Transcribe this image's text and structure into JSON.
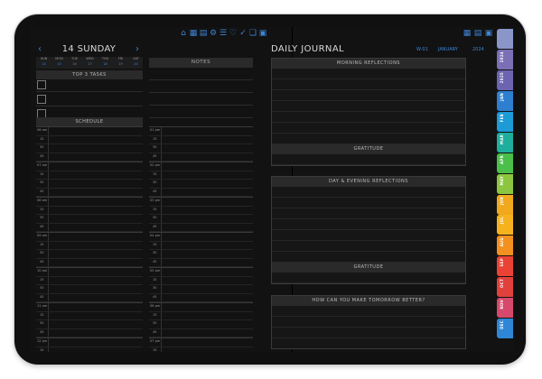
{
  "date_header": {
    "title": "14 SUNDAY",
    "prev": "‹",
    "next": "›"
  },
  "week": {
    "days": [
      "SUN",
      "MON",
      "TUE",
      "WED",
      "THU",
      "FRI",
      "SAT"
    ],
    "dates": [
      "14",
      "15",
      "16",
      "17",
      "18",
      "19",
      "20"
    ]
  },
  "top_icons": [
    "home-icon",
    "calendar-icon",
    "grid-icon",
    "gear-icon",
    "list-icon",
    "heart-icon",
    "checklist-icon",
    "bookmark-icon",
    "clipboard-icon"
  ],
  "right_icons": [
    "grid-icon",
    "calendar-icon",
    "document-icon"
  ],
  "sections": {
    "top_tasks": "TOP 3 TASKS",
    "schedule": "SCHEDULE",
    "notes": "NOTES"
  },
  "schedule_left": [
    {
      "hour": "06 am",
      "q": [
        "15",
        "30",
        "45"
      ]
    },
    {
      "hour": "07 am",
      "q": [
        "15",
        "30",
        "45"
      ]
    },
    {
      "hour": "08 am",
      "q": [
        "15",
        "30",
        "45"
      ]
    },
    {
      "hour": "09 am",
      "q": [
        "15",
        "30",
        "45"
      ]
    },
    {
      "hour": "10 am",
      "q": [
        "15",
        "30",
        "45"
      ]
    },
    {
      "hour": "11 am",
      "q": [
        "15",
        "30",
        "45"
      ]
    },
    {
      "hour": "12 pm",
      "q": [
        "15",
        "30",
        "45"
      ]
    }
  ],
  "schedule_right": [
    {
      "hour": "01 pm",
      "q": [
        "15",
        "30",
        "45"
      ]
    },
    {
      "hour": "02 pm",
      "q": [
        "15",
        "30",
        "45"
      ]
    },
    {
      "hour": "03 pm",
      "q": [
        "15",
        "30",
        "45"
      ]
    },
    {
      "hour": "04 pm",
      "q": [
        "15",
        "30",
        "45"
      ]
    },
    {
      "hour": "05 pm",
      "q": [
        "15",
        "30",
        "45"
      ]
    },
    {
      "hour": "06 pm",
      "q": [
        "15",
        "30",
        "45"
      ]
    },
    {
      "hour": "07 pm",
      "q": [
        "15",
        "30",
        "45"
      ]
    }
  ],
  "journal": {
    "title": "DAILY JOURNAL",
    "week_label": "W-01",
    "month_label": "JANUARY",
    "year_label": "2024",
    "morning": "MORNING REFLECTIONS",
    "gratitude1": "GRATITUDE",
    "evening": "DAY & EVENING REFLECTIONS",
    "gratitude2": "GRATITUDE",
    "tomorrow": "HOW CAN YOU MAKE TOMORROW BETTER?"
  },
  "side_tabs": [
    {
      "label": "",
      "color": "#8a96c8"
    },
    {
      "label": "2024",
      "color": "#7b6fb6"
    },
    {
      "label": "2025",
      "color": "#6c64b0"
    },
    {
      "label": "JAN",
      "color": "#2f7fd0"
    },
    {
      "label": "FEB",
      "color": "#1d9bd6"
    },
    {
      "label": "MAR",
      "color": "#1fae9d"
    },
    {
      "label": "APR",
      "color": "#4bbf4a"
    },
    {
      "label": "MAY",
      "color": "#8cc63f"
    },
    {
      "label": "JUN",
      "color": "#f0a81f"
    },
    {
      "label": "JUL",
      "color": "#f5b21e"
    },
    {
      "label": "AUG",
      "color": "#f3901f"
    },
    {
      "label": "SEP",
      "color": "#ea4335"
    },
    {
      "label": "OCT",
      "color": "#e0413c"
    },
    {
      "label": "NOV",
      "color": "#d6496c"
    },
    {
      "label": "DEC",
      "color": "#2f86d6"
    }
  ]
}
